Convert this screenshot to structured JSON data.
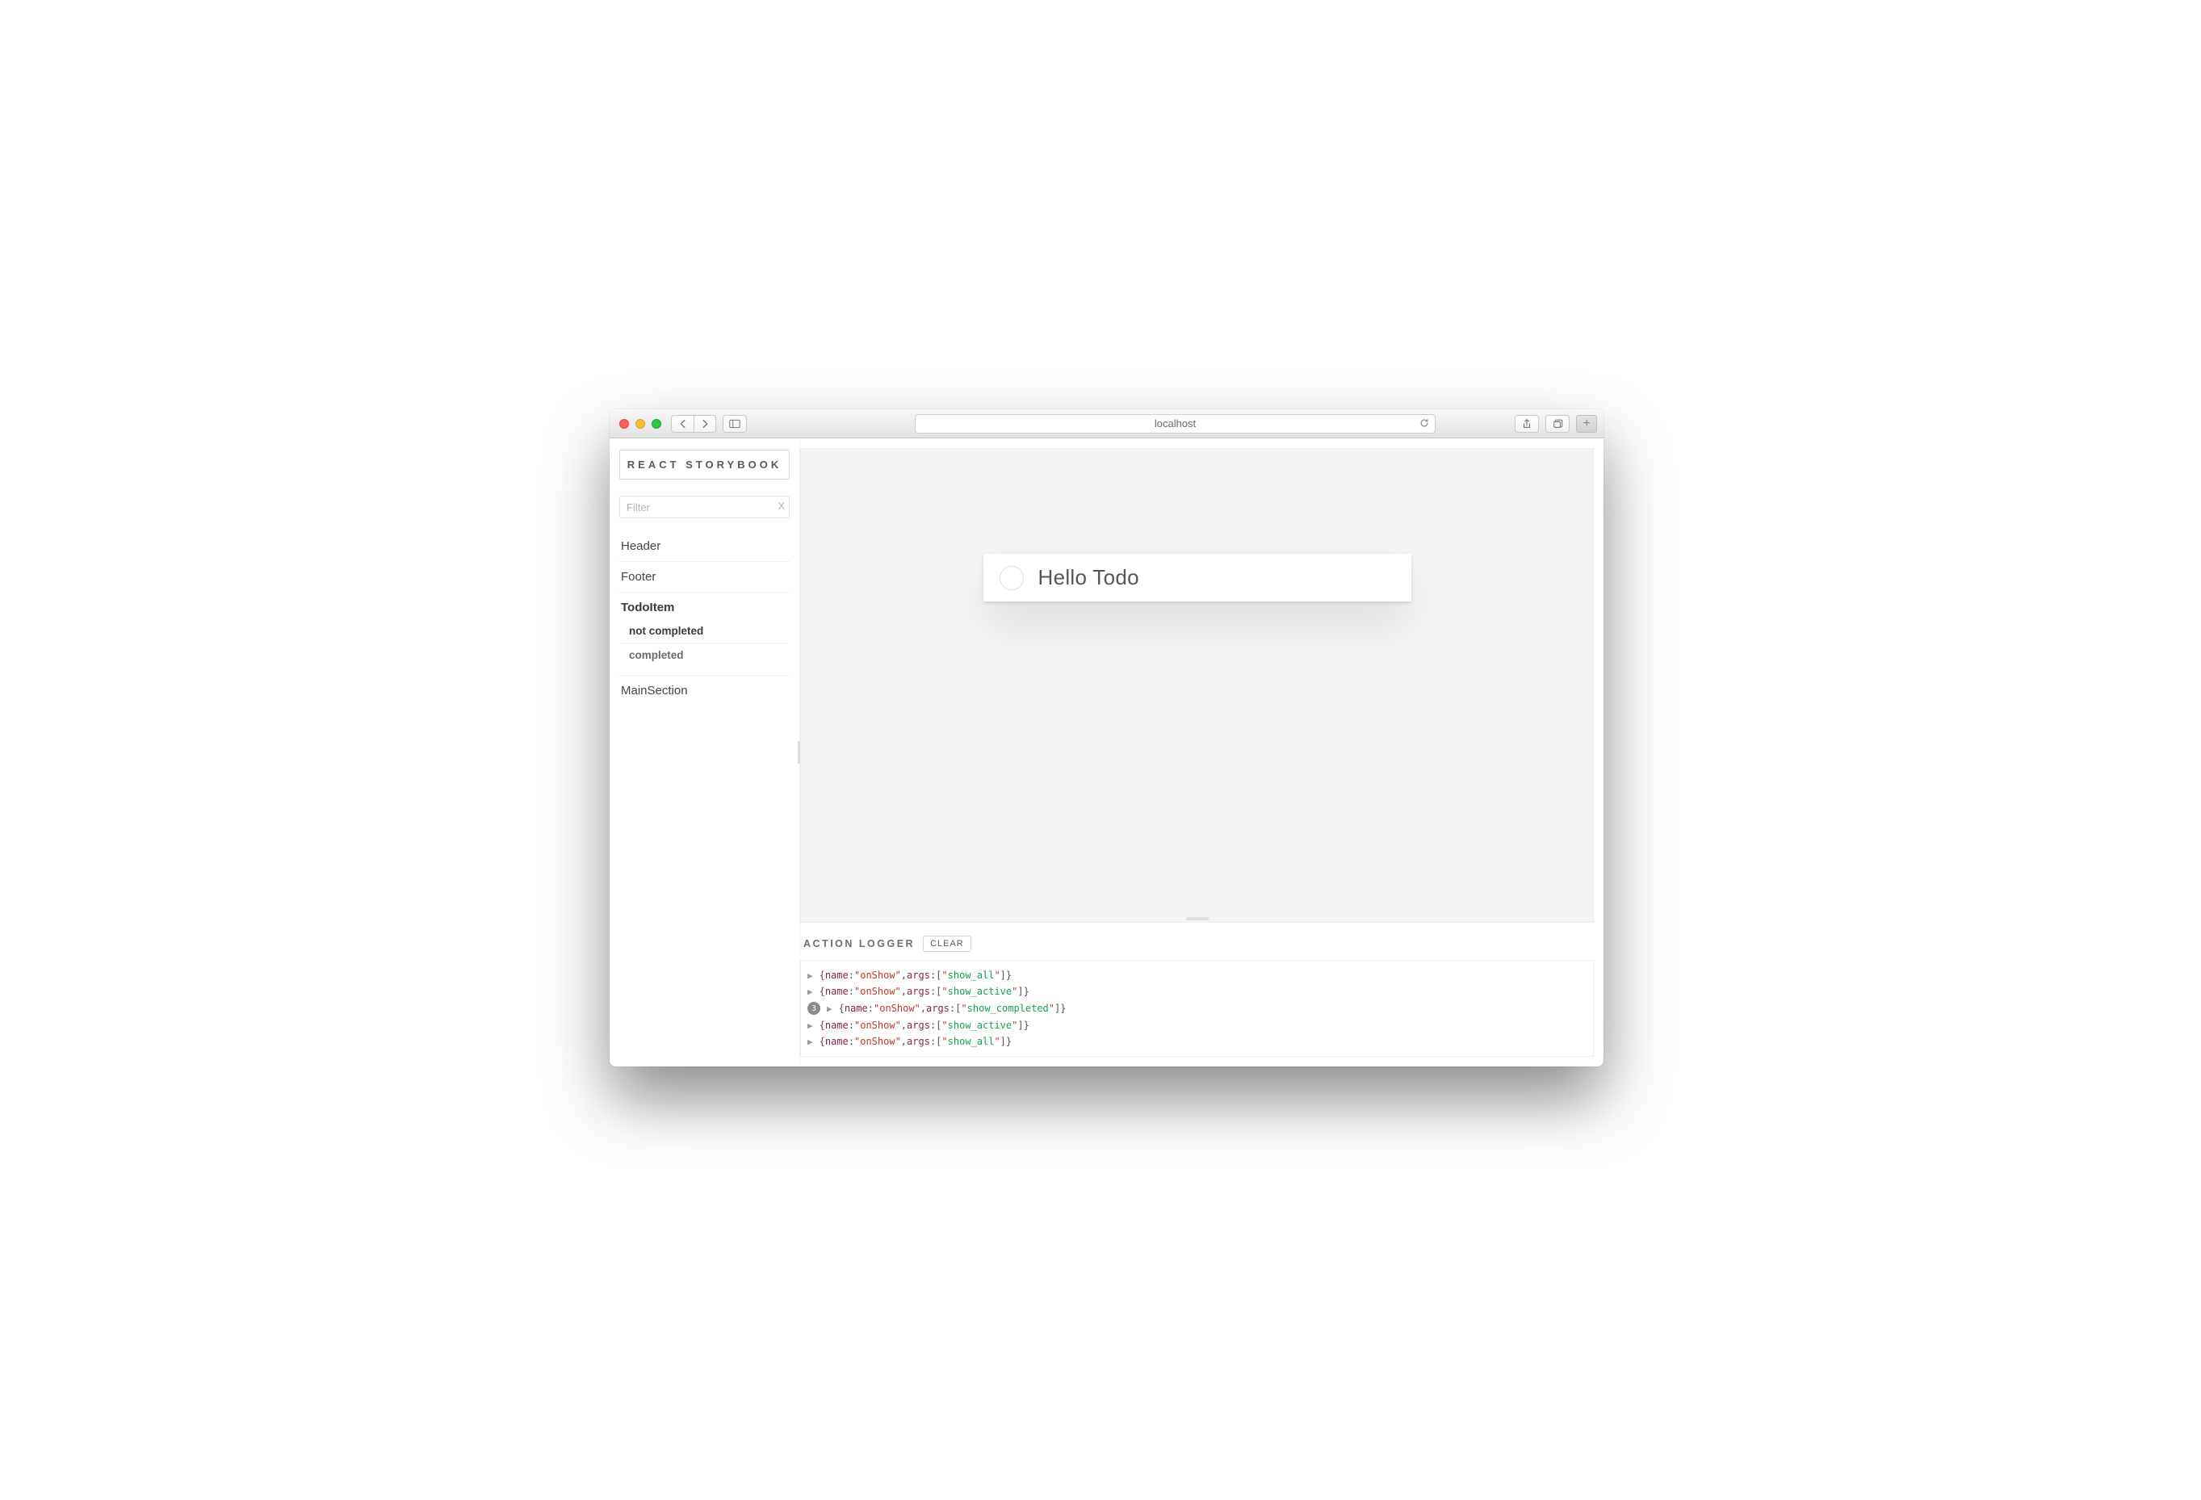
{
  "browser": {
    "url_text": "localhost"
  },
  "sidebar": {
    "brand": "REACT STORYBOOK",
    "filter_placeholder": "Filter",
    "filter_clear_label": "X",
    "components": [
      {
        "label": "Header",
        "active": false
      },
      {
        "label": "Footer",
        "active": false
      },
      {
        "label": "TodoItem",
        "active": true,
        "stories": [
          {
            "label": "not completed",
            "active": true
          },
          {
            "label": "completed",
            "active": false
          }
        ]
      },
      {
        "label": "MainSection",
        "active": false
      }
    ]
  },
  "preview": {
    "todo_text": "Hello Todo"
  },
  "logger": {
    "title": "ACTION LOGGER",
    "clear_label": "CLEAR",
    "entries": [
      {
        "count": null,
        "name": "onShow",
        "args": [
          "show_all"
        ]
      },
      {
        "count": null,
        "name": "onShow",
        "args": [
          "show_active"
        ]
      },
      {
        "count": 3,
        "name": "onShow",
        "args": [
          "show_completed"
        ]
      },
      {
        "count": null,
        "name": "onShow",
        "args": [
          "show_active"
        ]
      },
      {
        "count": null,
        "name": "onShow",
        "args": [
          "show_all"
        ]
      }
    ]
  }
}
